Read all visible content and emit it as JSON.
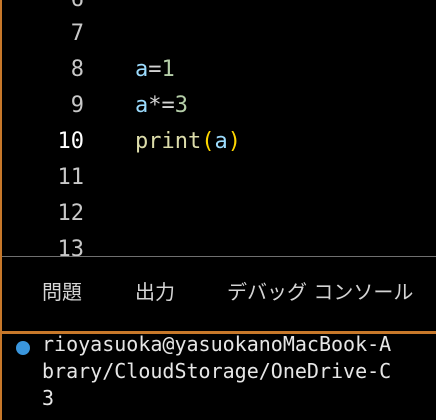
{
  "editor": {
    "lines": [
      {
        "number": "6",
        "code": ""
      },
      {
        "number": "7",
        "code": ""
      },
      {
        "number": "8",
        "code_tokens": {
          "var": "a",
          "op": "=",
          "num": "1"
        }
      },
      {
        "number": "9",
        "code_tokens": {
          "var": "a",
          "op": "*=",
          "num": "3"
        }
      },
      {
        "number": "10",
        "code_tokens": {
          "fn": "print",
          "open": "(",
          "arg": "a",
          "close": ")"
        }
      },
      {
        "number": "11",
        "code": ""
      },
      {
        "number": "12",
        "code": ""
      },
      {
        "number": "13",
        "code": ""
      }
    ]
  },
  "panel": {
    "tabs": [
      "問題",
      "出力",
      "デバッグ コンソール"
    ]
  },
  "terminal": {
    "lines": [
      "rioyasuoka@yasuokanoMacBook-A",
      "brary/CloudStorage/OneDrive-C",
      "3"
    ]
  },
  "colors": {
    "background": "#000000",
    "accent_border": "#c7782a",
    "terminal_dot": "#3a96dd",
    "variable": "#9cdcfe",
    "number": "#b5cea8",
    "function": "#dcdcaa",
    "bracket": "#ffd700"
  },
  "icons": {
    "terminal_status": "circle-dot-icon"
  }
}
